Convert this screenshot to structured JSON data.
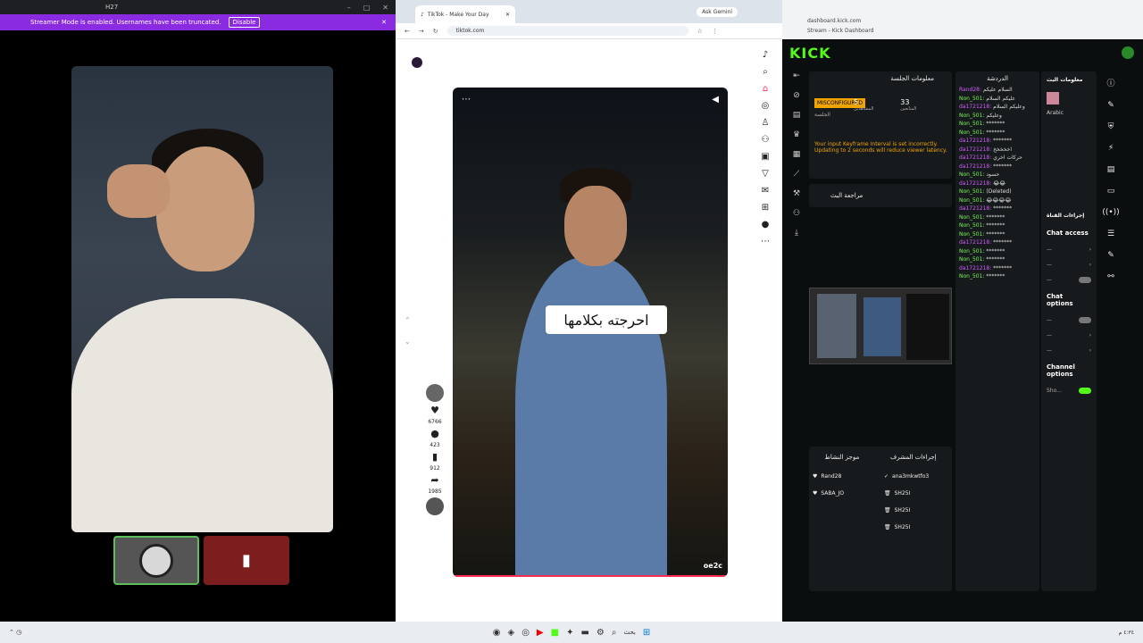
{
  "left_window": {
    "title": "H27",
    "streamer_banner": "Streamer Mode is enabled. Usernames have been truncated.",
    "disable_label": "Disable"
  },
  "browser": {
    "tab_title": "TikTok - Make Your Day",
    "ask_label": "Ask Gemini",
    "url": "tiktok.com",
    "caption": "احرجته بكلامها",
    "watermark": "oe2c",
    "likes": "6766",
    "comments": "423",
    "saves": "912",
    "shares": "1985"
  },
  "kick": {
    "url": "dashboard.kick.com",
    "page_label": "Stream - Kick Dashboard",
    "logo": "KICK",
    "session_title": "معلومات الجلسة",
    "status_badge": "MISCONFIGURED",
    "session_label": "الجلسة",
    "viewers_label": "المشاهدين",
    "viewers": "5",
    "followers_label": "المتابعين",
    "followers": "33",
    "warning": "Your input Keyframe Interval is set incorrectly. Updating to 2 seconds will reduce viewer latency.",
    "review_title": "مراجعة البث",
    "chat_title": "الدردشة",
    "stream_info_title": "معلومات البث",
    "language": "Arabic",
    "channel_actions_title": "إجراءات القناة",
    "chat_access": "Chat access",
    "chat_options": "Chat options",
    "channel_options": "Channel options",
    "show_label": "Sho...",
    "mod_actions_title": "إجراءات المشرف",
    "recent_title": "موجز النشاط",
    "mod_rows": [
      {
        "name": "ana3mkwtfo3"
      },
      {
        "name": "SH25I"
      },
      {
        "name": "SH25I"
      },
      {
        "name": "SH25I"
      }
    ],
    "recent_rows": [
      {
        "name": "Rand28"
      },
      {
        "name": "SABA_JO"
      }
    ],
    "chat_messages": [
      {
        "user": "Rand28:",
        "text": "السلام عليكم",
        "cls": "u1"
      },
      {
        "user": "Non_501:",
        "text": "عليكم السلام",
        "cls": "u2"
      },
      {
        "user": "da1721218:",
        "text": "وعليكم السلام",
        "cls": "u1"
      },
      {
        "user": "Non_501:",
        "text": "وعليكم",
        "cls": "u2"
      },
      {
        "user": "Non_501:",
        "text": "*******",
        "cls": "u2"
      },
      {
        "user": "Non_501:",
        "text": "*******",
        "cls": "u2"
      },
      {
        "user": "da1721218:",
        "text": "*******",
        "cls": "u1"
      },
      {
        "user": "da1721218:",
        "text": "اخخخخخ",
        "cls": "u1"
      },
      {
        "user": "da1721218:",
        "text": "حركات اخري",
        "cls": "u1"
      },
      {
        "user": "da1721218:",
        "text": "*******",
        "cls": "u1"
      },
      {
        "user": "Non_501:",
        "text": "حسود",
        "cls": "u2"
      },
      {
        "user": "da1721218:",
        "text": "😂😂",
        "cls": "u1"
      },
      {
        "user": "Non_501:",
        "text": "(Deleted)",
        "cls": "u2"
      },
      {
        "user": "Non_501:",
        "text": "😂😂😂😂",
        "cls": "u2"
      },
      {
        "user": "da1721218:",
        "text": "*******",
        "cls": "u1"
      },
      {
        "user": "Non_501:",
        "text": "*******",
        "cls": "u2"
      },
      {
        "user": "Non_501:",
        "text": "*******",
        "cls": "u2"
      },
      {
        "user": "Non_501:",
        "text": "*******",
        "cls": "u2"
      },
      {
        "user": "da1721218:",
        "text": "*******",
        "cls": "u1"
      },
      {
        "user": "Non_501:",
        "text": "*******",
        "cls": "u2"
      },
      {
        "user": "Non_501:",
        "text": "*******",
        "cls": "u2"
      },
      {
        "user": "da1721218:",
        "text": "*******",
        "cls": "u1"
      },
      {
        "user": "Non_501:",
        "text": "*******",
        "cls": "u2"
      }
    ]
  },
  "taskbar": {
    "search_label": "بحث",
    "clock": "٤:٣٤ م"
  }
}
